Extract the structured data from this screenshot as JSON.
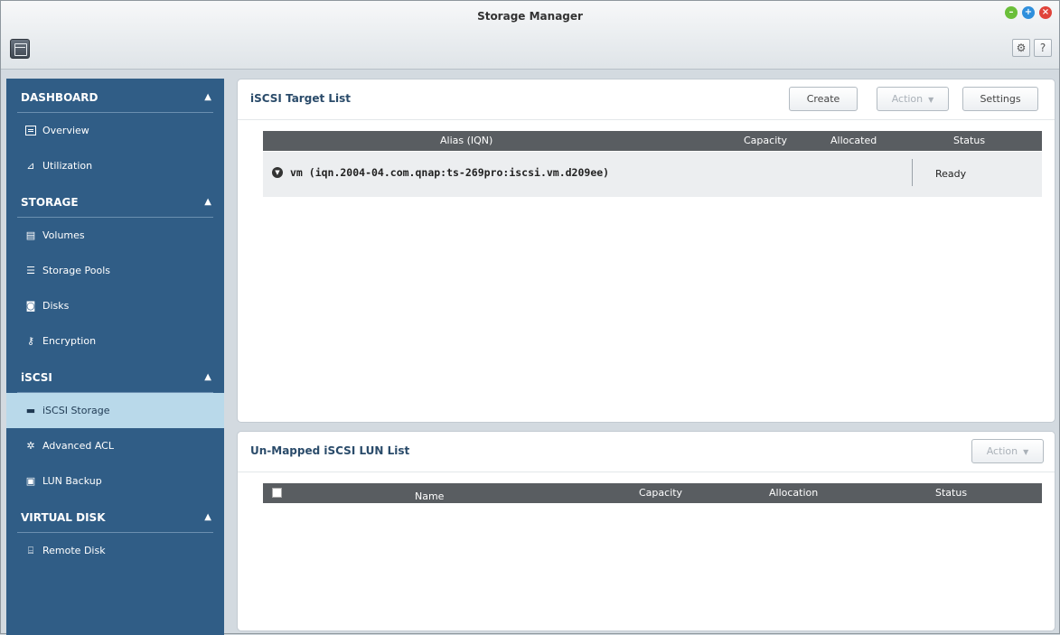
{
  "window": {
    "title": "Storage Manager"
  },
  "sidebar": {
    "sections": [
      {
        "label": "DASHBOARD",
        "items": [
          {
            "label": "Overview",
            "icon": "overview-icon"
          },
          {
            "label": "Utilization",
            "icon": "utilization-icon"
          }
        ]
      },
      {
        "label": "STORAGE",
        "items": [
          {
            "label": "Volumes",
            "icon": "volumes-icon"
          },
          {
            "label": "Storage Pools",
            "icon": "storage-pools-icon"
          },
          {
            "label": "Disks",
            "icon": "disks-icon"
          },
          {
            "label": "Encryption",
            "icon": "encryption-icon"
          }
        ]
      },
      {
        "label": "iSCSI",
        "items": [
          {
            "label": "iSCSI Storage",
            "icon": "iscsi-storage-icon",
            "active": true
          },
          {
            "label": "Advanced ACL",
            "icon": "advanced-acl-icon"
          },
          {
            "label": "LUN Backup",
            "icon": "lun-backup-icon"
          }
        ]
      },
      {
        "label": "VIRTUAL DISK",
        "items": [
          {
            "label": "Remote Disk",
            "icon": "remote-disk-icon"
          }
        ]
      }
    ]
  },
  "target_list": {
    "title": "iSCSI Target List",
    "buttons": {
      "create": "Create",
      "action": "Action",
      "settings": "Settings"
    },
    "columns": [
      "Alias (IQN)",
      "Capacity",
      "Allocated",
      "Status"
    ],
    "rows": [
      {
        "alias": "vm (iqn.2004-04.com.qnap:ts-269pro:iscsi.vm.d209ee)",
        "status": "Ready"
      }
    ]
  },
  "lun_list": {
    "title": "Un-Mapped iSCSI LUN List",
    "buttons": {
      "action": "Action"
    },
    "columns": [
      "Name",
      "Capacity",
      "Allocation",
      "Status"
    ]
  },
  "colors": {
    "sidebar_bg": "#305d86",
    "active_item_bg": "#b9d9ea",
    "table_header_bg": "#595d61"
  }
}
